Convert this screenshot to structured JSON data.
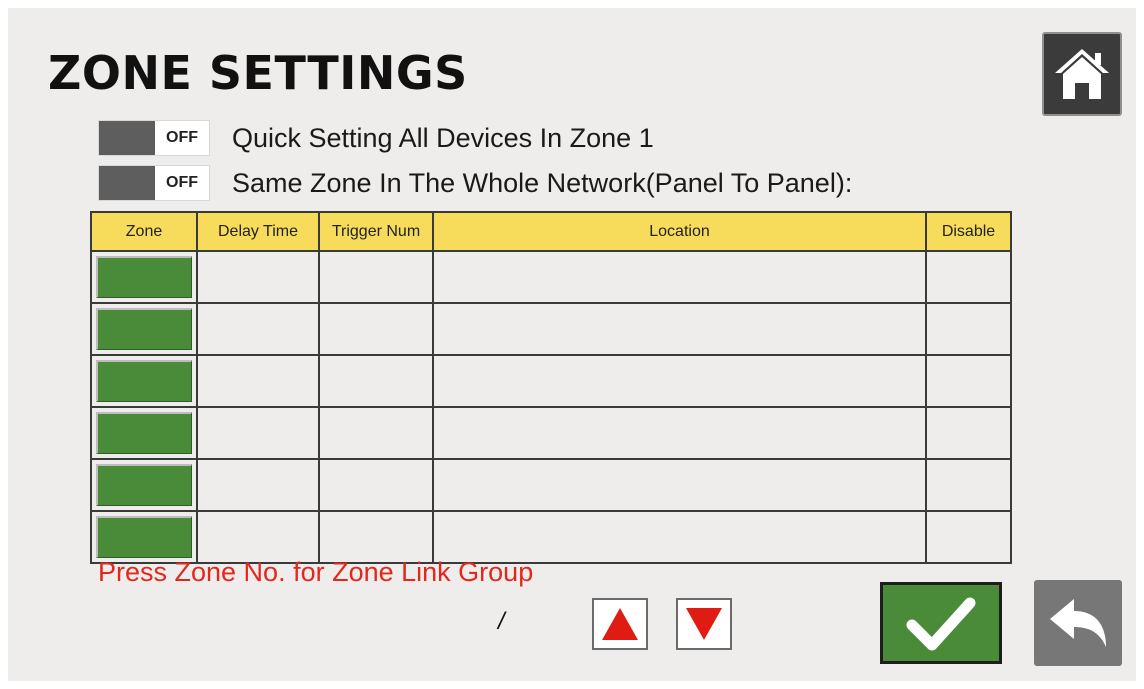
{
  "header": {
    "title": "ZONE SETTINGS",
    "home_icon": "home-icon"
  },
  "toggles": [
    {
      "state": "OFF",
      "label": "Quick Setting All Devices In Zone 1"
    },
    {
      "state": "OFF",
      "label": "Same Zone In The Whole Network(Panel To Panel):"
    }
  ],
  "table": {
    "columns": [
      "Zone",
      "Delay Time",
      "Trigger Num",
      "Location",
      "Disable"
    ],
    "header_color": "#f7dc5c",
    "zone_button_color": "#4a8b3a",
    "rows": [
      {
        "zone": "",
        "delay_time": "",
        "trigger_num": "",
        "location": "",
        "disable": ""
      },
      {
        "zone": "",
        "delay_time": "",
        "trigger_num": "",
        "location": "",
        "disable": ""
      },
      {
        "zone": "",
        "delay_time": "",
        "trigger_num": "",
        "location": "",
        "disable": ""
      },
      {
        "zone": "",
        "delay_time": "",
        "trigger_num": "",
        "location": "",
        "disable": ""
      },
      {
        "zone": "",
        "delay_time": "",
        "trigger_num": "",
        "location": "",
        "disable": ""
      },
      {
        "zone": "",
        "delay_time": "",
        "trigger_num": "",
        "location": "",
        "disable": ""
      }
    ]
  },
  "footer": {
    "hint": "Press Zone No. for Zone Link  Group",
    "hint_color": "#e3271d",
    "page_indicator": "/",
    "up_icon": "triangle-up-icon",
    "down_icon": "triangle-down-icon",
    "confirm_icon": "checkmark-icon",
    "back_icon": "back-arrow-icon"
  }
}
